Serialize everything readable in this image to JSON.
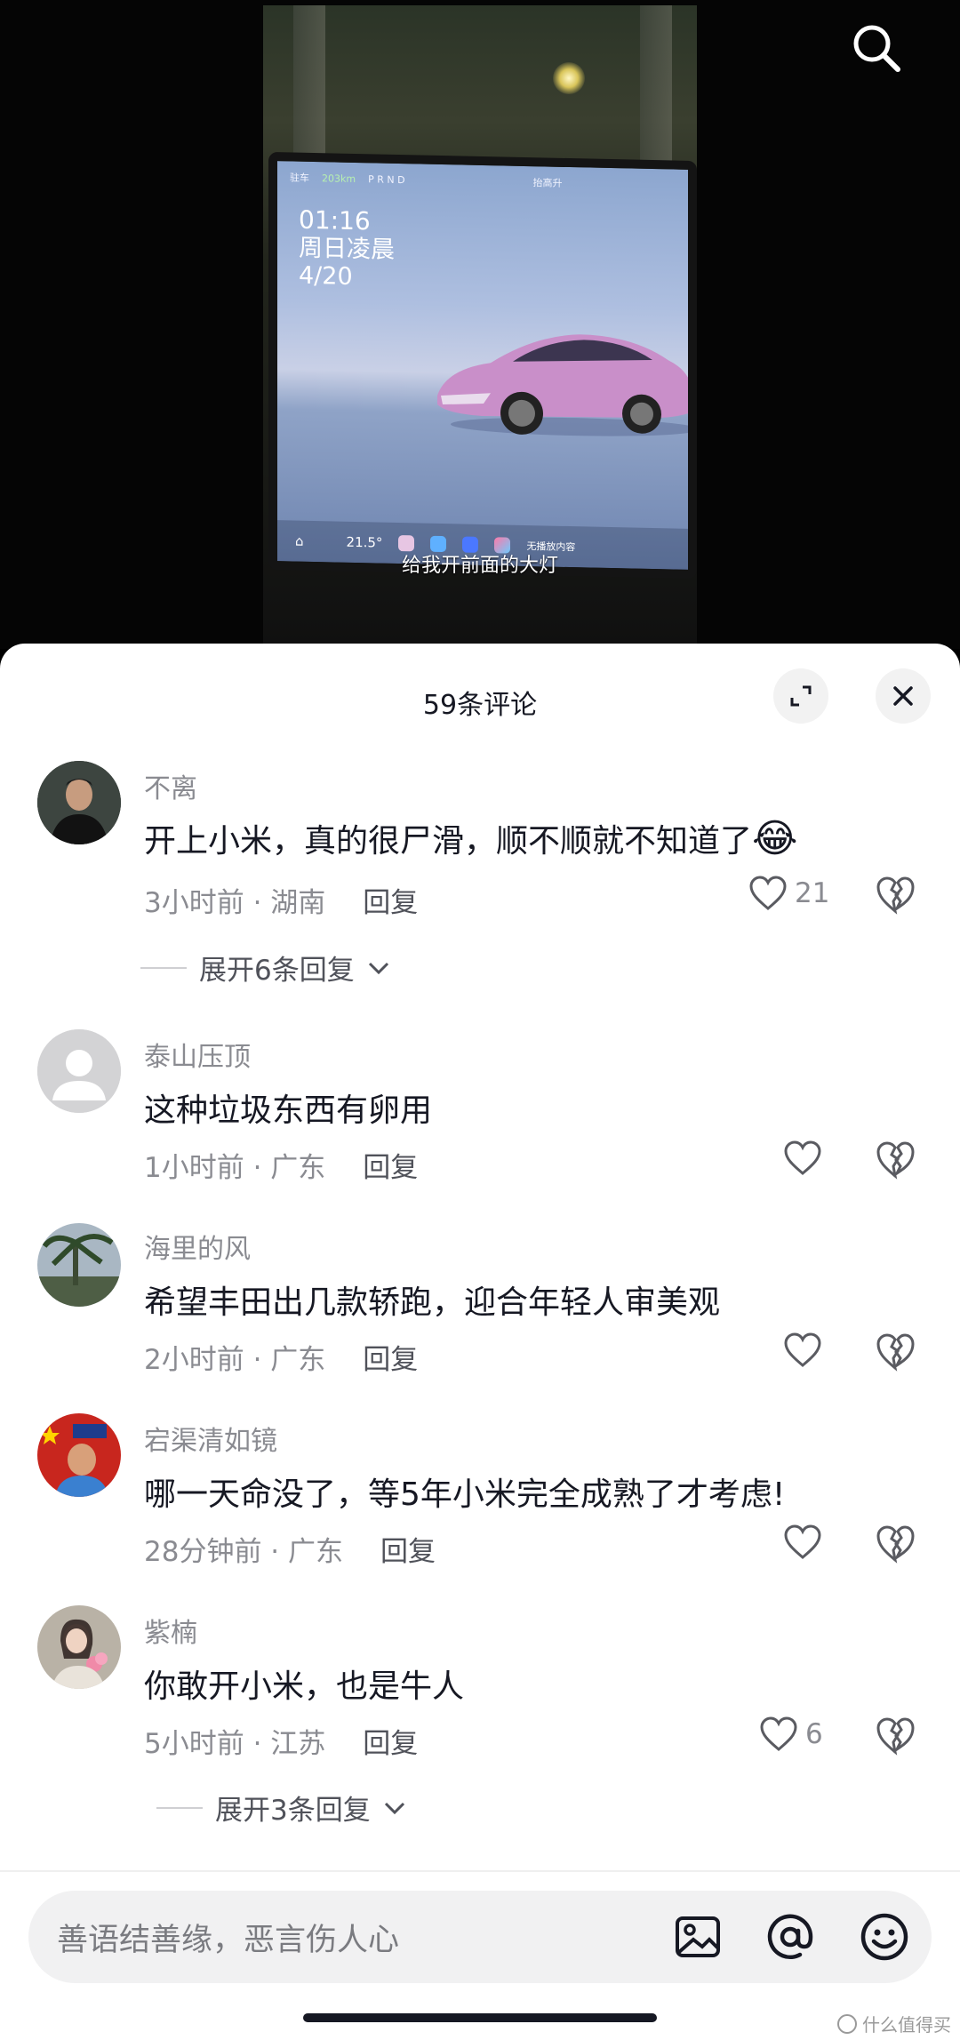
{
  "video": {
    "subtitle": "给我开前面的大灯",
    "screen": {
      "status_left": "驻车",
      "status_range": "203km",
      "gear": "P R N D",
      "top_center": "抬高升",
      "time": "01:16",
      "day": "周日凌晨",
      "date": "4/20",
      "temperature": "21.5°",
      "media": "无播放内容"
    },
    "search_icon": "search-icon"
  },
  "sheet": {
    "title": "59条评论",
    "expand_icon": "expand-icon",
    "close_icon": "close-icon"
  },
  "comments": [
    {
      "name": "不离",
      "text": "开上小米，真的很尸滑，顺不顺就不知道了",
      "emoji": "😂",
      "time": "3小时前",
      "location": "湖南",
      "reply": "回复",
      "likes": "21",
      "expand": "展开6条回复"
    },
    {
      "name": "泰山压顶",
      "text": "这种垃圾东西有卵用",
      "time": "1小时前",
      "location": "广东",
      "reply": "回复",
      "likes": ""
    },
    {
      "name": "海里的风",
      "text": "希望丰田出几款轿跑，迎合年轻人审美观",
      "time": "2小时前",
      "location": "广东",
      "reply": "回复",
      "likes": ""
    },
    {
      "name": "宕渠清如镜",
      "text": "哪一天命没了，等5年小米完全成熟了才考虑!",
      "time": "28分钟前",
      "location": "广东",
      "reply": "回复",
      "likes": ""
    },
    {
      "name": "紫楠",
      "text": "你敢开小米，也是牛人",
      "time": "5小时前",
      "location": "江苏",
      "reply": "回复",
      "likes": "6",
      "expand": "展开3条回复"
    }
  ],
  "input": {
    "placeholder": "善语结善缘，恶言伤人心",
    "icons": [
      "image-icon",
      "at-icon",
      "emoji-icon"
    ]
  },
  "watermark": "什么值得买",
  "colors": {
    "text_primary": "#161823",
    "text_secondary": "#8a8b91",
    "sheet_bg": "#ffffff"
  }
}
